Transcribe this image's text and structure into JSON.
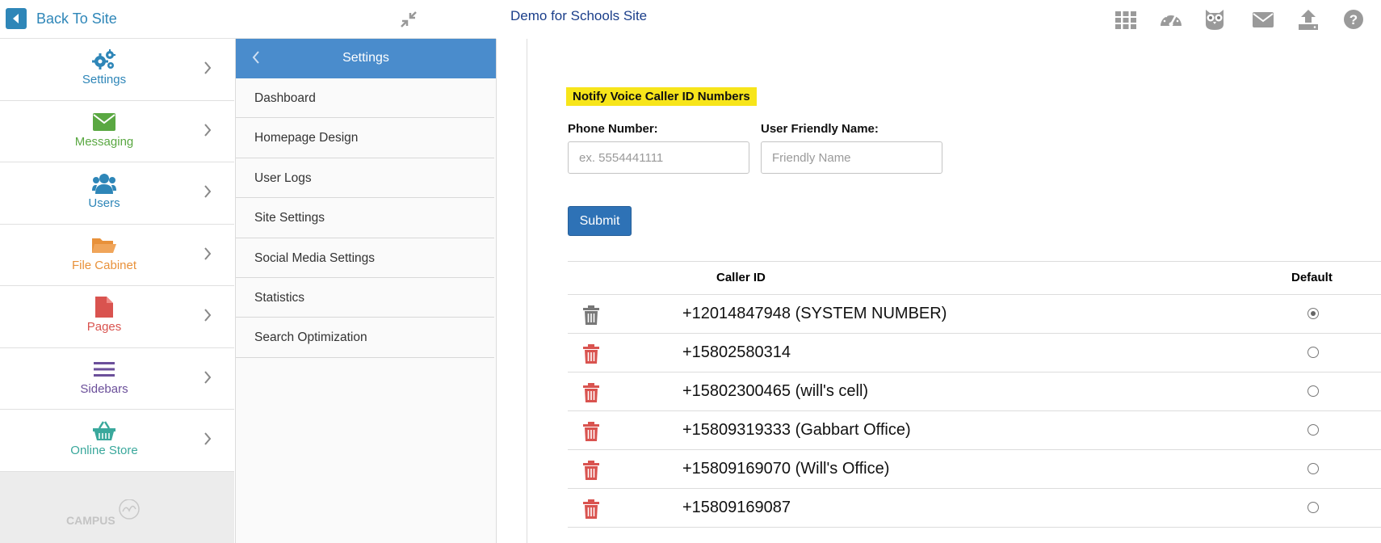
{
  "back": {
    "label": "Back To Site"
  },
  "site_title": "Demo for Schools Site",
  "nav": [
    {
      "label": "Settings",
      "icon": "gears-icon",
      "color": "#2e86b8"
    },
    {
      "label": "Messaging",
      "icon": "envelope-icon",
      "color": "#5aa842"
    },
    {
      "label": "Users",
      "icon": "users-icon",
      "color": "#2e86b8"
    },
    {
      "label": "File Cabinet",
      "icon": "folder-icon",
      "color": "#e8913a"
    },
    {
      "label": "Pages",
      "icon": "page-icon",
      "color": "#d9534f"
    },
    {
      "label": "Sidebars",
      "icon": "bars-icon",
      "color": "#6b4f9a"
    },
    {
      "label": "Online Store",
      "icon": "basket-icon",
      "color": "#3aa89c"
    }
  ],
  "logo_text": "CAMPUS",
  "submenu": {
    "title": "Settings",
    "items": [
      "Dashboard",
      "Homepage Design",
      "User Logs",
      "Site Settings",
      "Social Media Settings",
      "Statistics",
      "Search Optimization"
    ]
  },
  "form": {
    "heading": "Notify Voice Caller ID Numbers",
    "phone_label": "Phone Number:",
    "phone_placeholder": "ex. 5554441111",
    "name_label": "User Friendly Name:",
    "name_placeholder": "Friendly Name",
    "submit_label": "Submit"
  },
  "table": {
    "col_caller": "Caller ID",
    "col_default": "Default",
    "rows": [
      {
        "number": "+12014847948 (SYSTEM NUMBER)",
        "default": true,
        "deletable": false
      },
      {
        "number": "+15802580314",
        "default": false,
        "deletable": true
      },
      {
        "number": "+15802300465 (will's cell)",
        "default": false,
        "deletable": true
      },
      {
        "number": "+15809319333 (Gabbart Office)",
        "default": false,
        "deletable": true
      },
      {
        "number": "+15809169070 (Will's Office)",
        "default": false,
        "deletable": true
      },
      {
        "number": "+15809169087",
        "default": false,
        "deletable": true
      }
    ]
  },
  "colors": {
    "accent": "#2e86b8",
    "submenu_header": "#4a8ccc",
    "submit": "#2e72b6",
    "highlight": "#f7e51a",
    "trash_active": "#d9534f",
    "trash_disabled": "#777777"
  }
}
